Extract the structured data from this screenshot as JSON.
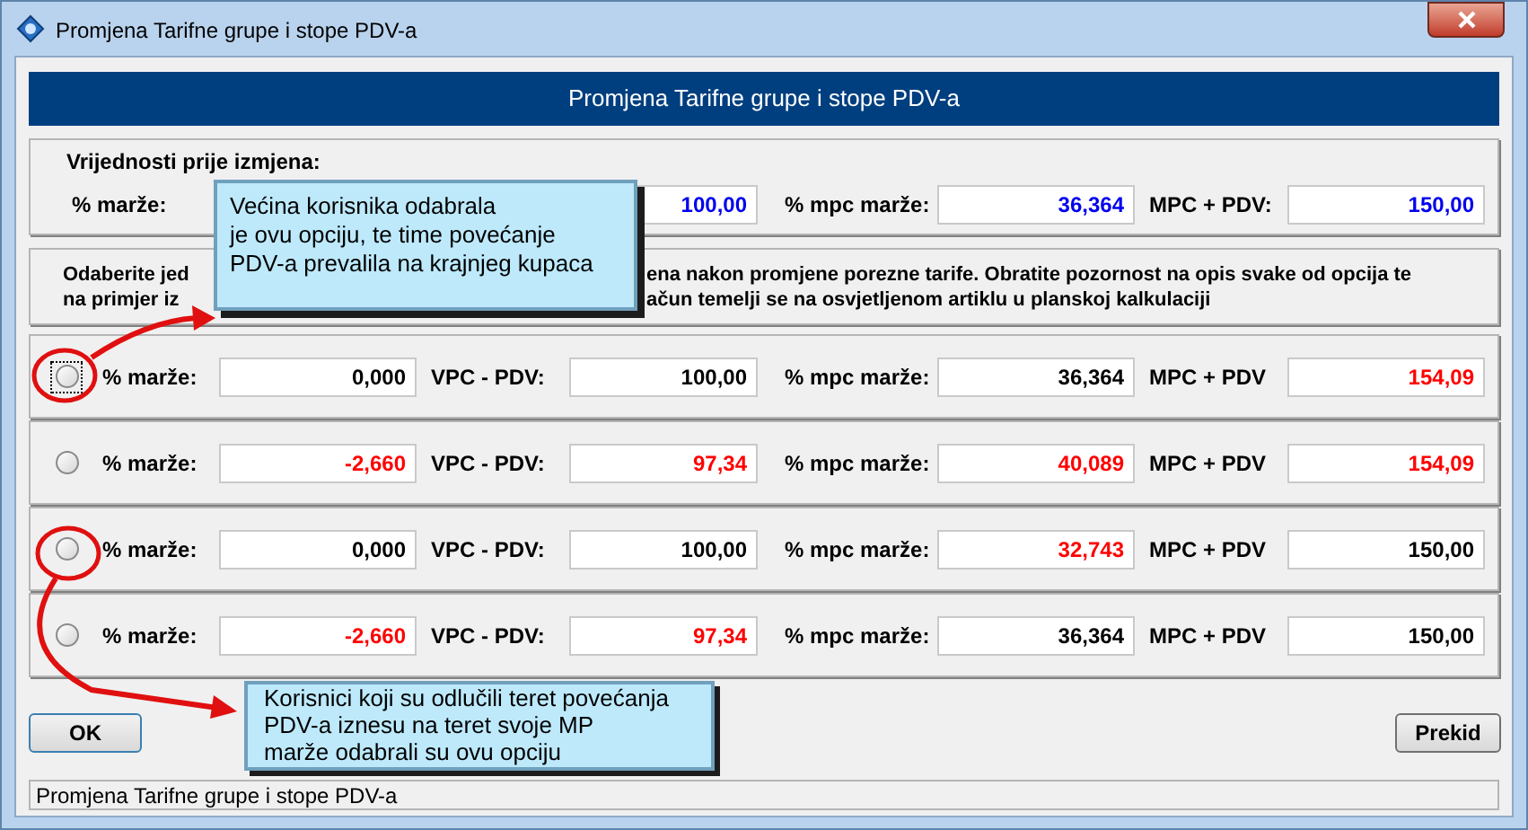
{
  "window": {
    "title": "Promjena Tarifne grupe i stope PDV-a"
  },
  "header": "Promjena Tarifne grupe i stope PDV-a",
  "before": {
    "title": "Vrijednosti prije izmjena:",
    "cells": [
      {
        "label": "% marže:"
      },
      {
        "value": "100,00"
      },
      {
        "label": "% mpc marže:",
        "value": "36,364"
      },
      {
        "label": "MPC + PDV:",
        "value": "150,00"
      }
    ]
  },
  "description": {
    "lines": [
      {
        "left": "Odaberite jed",
        "right": "ena nakon promjene porezne tarife. Obratite pozornost na opis svake od opcija te"
      },
      {
        "left": "na primjer iz",
        "right": "ačun temelji se na osvjetljenom artiklu u planskoj kalkulaciji"
      }
    ]
  },
  "options": [
    {
      "selected": false,
      "focused": true,
      "cells": [
        {
          "label": "% marže:",
          "value": "0,000",
          "changed": false
        },
        {
          "label": "VPC - PDV:",
          "value": "100,00",
          "changed": false
        },
        {
          "label": "% mpc marže:",
          "value": "36,364",
          "changed": false
        },
        {
          "label": "MPC + PDV",
          "value": "154,09",
          "changed": true
        }
      ]
    },
    {
      "selected": false,
      "focused": false,
      "cells": [
        {
          "label": "% marže:",
          "value": "-2,660",
          "changed": true
        },
        {
          "label": "VPC - PDV:",
          "value": "97,34",
          "changed": true
        },
        {
          "label": "% mpc marže:",
          "value": "40,089",
          "changed": true
        },
        {
          "label": "MPC + PDV",
          "value": "154,09",
          "changed": true
        }
      ]
    },
    {
      "selected": false,
      "focused": false,
      "cells": [
        {
          "label": "% marže:",
          "value": "0,000",
          "changed": false
        },
        {
          "label": "VPC - PDV:",
          "value": "100,00",
          "changed": false
        },
        {
          "label": "% mpc marže:",
          "value": "32,743",
          "changed": true
        },
        {
          "label": "MPC + PDV",
          "value": "150,00",
          "changed": false
        }
      ]
    },
    {
      "selected": false,
      "focused": false,
      "cells": [
        {
          "label": "% marže:",
          "value": "-2,660",
          "changed": true
        },
        {
          "label": "VPC - PDV:",
          "value": "97,34",
          "changed": true
        },
        {
          "label": "% mpc marže:",
          "value": "36,364",
          "changed": false
        },
        {
          "label": "MPC + PDV",
          "value": "150,00",
          "changed": false
        }
      ]
    }
  ],
  "buttons": {
    "ok": "OK",
    "cancel": "Prekid"
  },
  "status_bar": "Promjena Tarifne grupe i stope PDV-a",
  "callouts": [
    "Većina korisnika odabrala\nje ovu opciju, te time povećanje\nPDV-a prevalila na krajnjeg kupaca",
    "Korisnici koji su odlučili teret povećanja\nPDV-a iznesu na teret svoje MP\nmarže odabrali su ovu opciju"
  ]
}
